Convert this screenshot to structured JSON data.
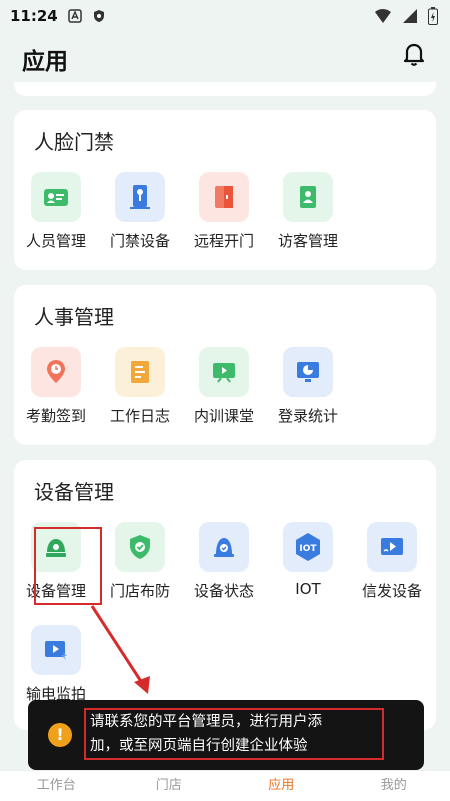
{
  "status_bar": {
    "time": "11:24"
  },
  "header": {
    "title": "应用"
  },
  "sections": [
    {
      "title": "人脸门禁",
      "items": [
        {
          "label": "人员管理",
          "icon": "id-card-icon"
        },
        {
          "label": "门禁设备",
          "icon": "access-device-icon"
        },
        {
          "label": "远程开门",
          "icon": "remote-door-icon"
        },
        {
          "label": "访客管理",
          "icon": "visitor-icon"
        }
      ]
    },
    {
      "title": "人事管理",
      "items": [
        {
          "label": "考勤签到",
          "icon": "location-clock-icon"
        },
        {
          "label": "工作日志",
          "icon": "log-icon"
        },
        {
          "label": "内训课堂",
          "icon": "classroom-icon"
        },
        {
          "label": "登录统计",
          "icon": "stats-monitor-icon"
        }
      ]
    },
    {
      "title": "设备管理",
      "items": [
        {
          "label": "设备管理",
          "icon": "camera-dome-icon"
        },
        {
          "label": "门店布防",
          "icon": "shield-icon"
        },
        {
          "label": "设备状态",
          "icon": "device-status-icon"
        },
        {
          "label": "IOT",
          "icon": "iot-icon"
        },
        {
          "label": "信发设备",
          "icon": "signage-icon"
        },
        {
          "label": "输电监拍",
          "icon": "power-camera-icon"
        }
      ]
    }
  ],
  "toast": {
    "line1": "请联系您的平台管理员，进行用户添",
    "line2": "加，或至网页端自行创建企业体验"
  },
  "bottom_nav": {
    "tabs": [
      {
        "label": "工作台"
      },
      {
        "label": "门店"
      },
      {
        "label": "应用"
      },
      {
        "label": "我的"
      }
    ],
    "active_index": 2
  },
  "colors": {
    "accent": "#e87423",
    "highlight": "#d62b2b",
    "toast_bg": "#141414"
  }
}
